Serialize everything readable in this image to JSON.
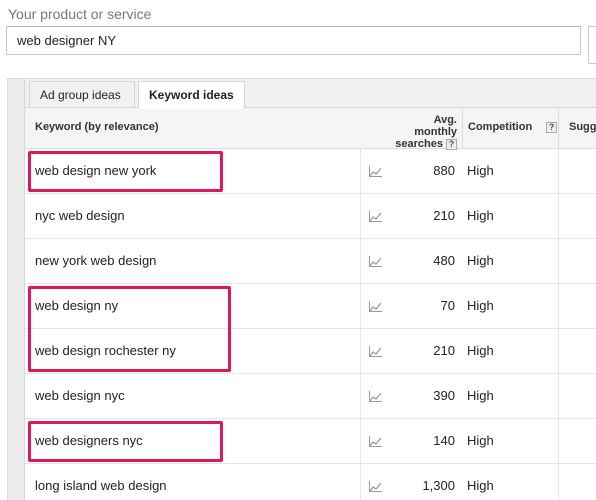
{
  "search": {
    "label": "Your product or service",
    "value": "web designer NY"
  },
  "tabs": [
    {
      "label": "Ad group ideas",
      "active": false
    },
    {
      "label": "Keyword ideas",
      "active": true
    }
  ],
  "table": {
    "headers": {
      "keyword": "Keyword (by relevance)",
      "searches_line1": "Avg. monthly",
      "searches_line2": "searches",
      "competition": "Competition",
      "suggested": "Sugg",
      "help": "?"
    },
    "rows": [
      {
        "keyword": "web design new york",
        "searches": "880",
        "competition": "High",
        "highlighted": true
      },
      {
        "keyword": "nyc web design",
        "searches": "210",
        "competition": "High",
        "highlighted": false
      },
      {
        "keyword": "new york web design",
        "searches": "480",
        "competition": "High",
        "highlighted": false
      },
      {
        "keyword": "web design ny",
        "searches": "70",
        "competition": "High",
        "highlighted": true
      },
      {
        "keyword": "web design rochester ny",
        "searches": "210",
        "competition": "High",
        "highlighted": true
      },
      {
        "keyword": "web design nyc",
        "searches": "390",
        "competition": "High",
        "highlighted": false
      },
      {
        "keyword": "web designers nyc",
        "searches": "140",
        "competition": "High",
        "highlighted": true
      },
      {
        "keyword": "long island web design",
        "searches": "1,300",
        "competition": "High",
        "highlighted": false
      }
    ]
  },
  "colors": {
    "highlight": "#e0175f",
    "trend_icon": "#9a9a9a"
  },
  "icons": {
    "trend": "trend-chart-icon",
    "help": "help-icon"
  }
}
